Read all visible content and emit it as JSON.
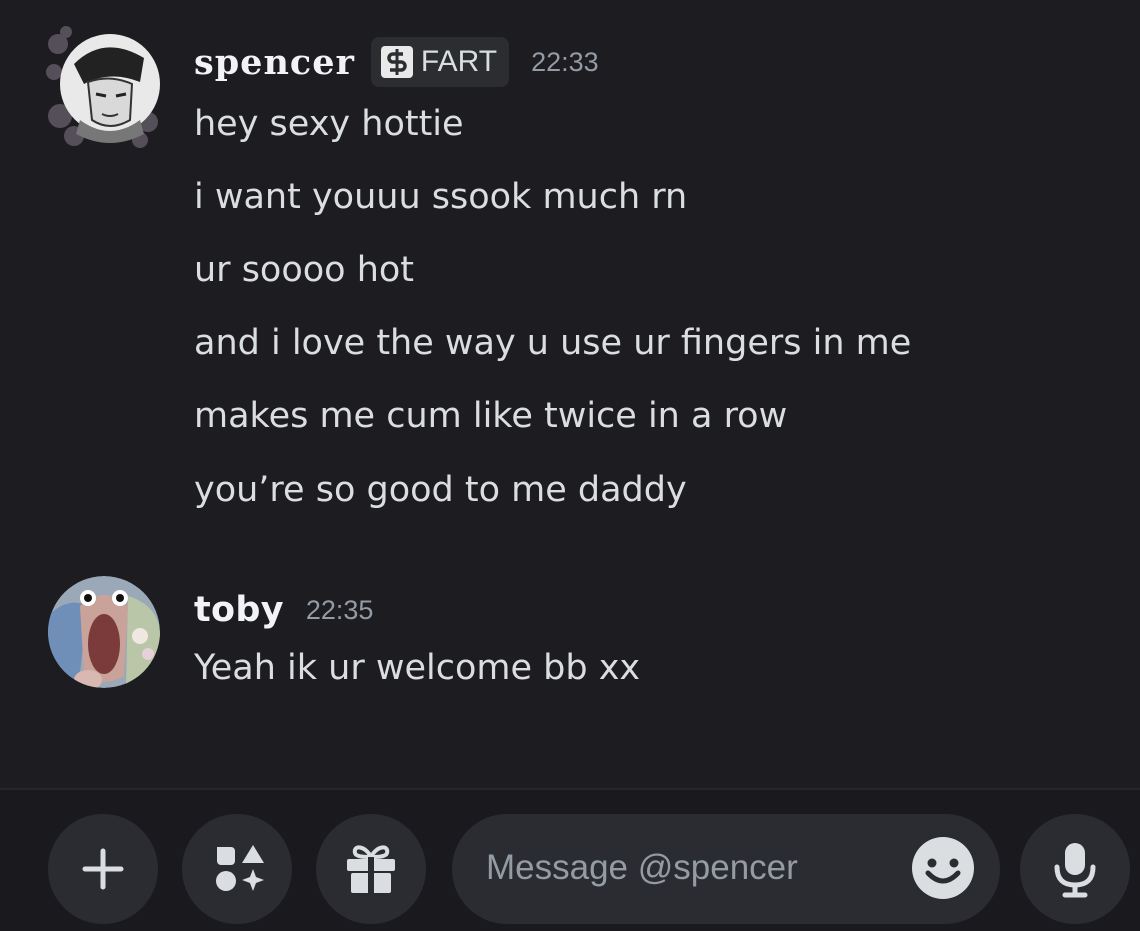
{
  "messages": [
    {
      "author": "spencer",
      "tag": "FART",
      "time": "22:33",
      "lines": [
        "hey sexy hottie",
        "i want youuu ssook much rn",
        "ur soooo hot",
        "and i love the way u use ur fingers in me",
        "makes me cum like twice in a row",
        "you’re so good to me daddy"
      ]
    },
    {
      "author": "toby",
      "time": "22:35",
      "lines": [
        "Yeah ik ur welcome bb xx"
      ]
    }
  ],
  "composer": {
    "placeholder": "Message @spencer"
  },
  "icons": {
    "add": "plus-icon",
    "apps": "apps-icon",
    "gift": "gift-icon",
    "emoji": "emoji-icon",
    "voice": "microphone-icon",
    "tag": "dollar-sign-icon"
  },
  "colors": {
    "background": "#1c1c21",
    "text": "#dbdee1",
    "timestamp": "#949ba4",
    "button": "#2b2c31"
  }
}
